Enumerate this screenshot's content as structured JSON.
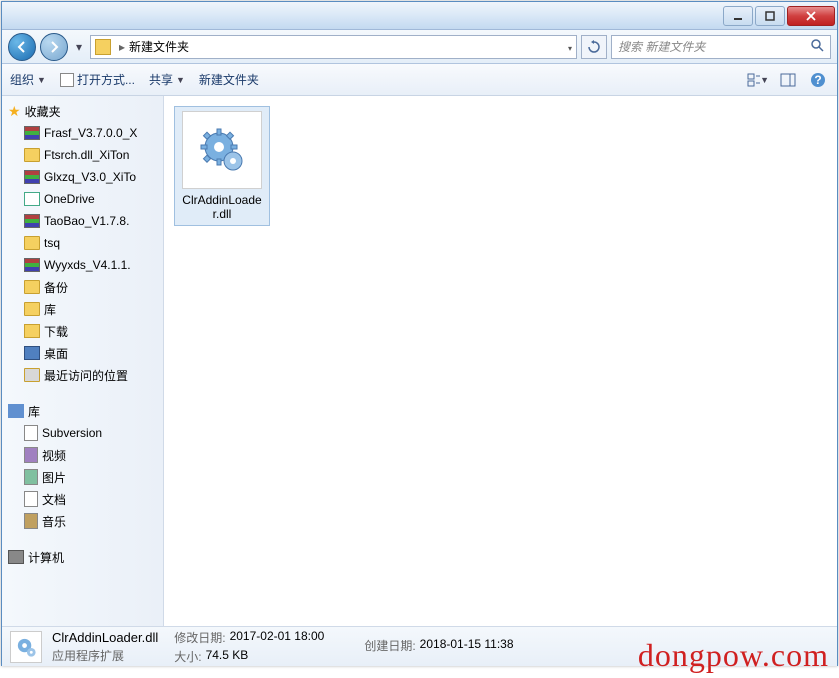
{
  "titlebar": {},
  "nav": {
    "path_item": "新建文件夹",
    "search_placeholder": "搜索 新建文件夹"
  },
  "toolbar": {
    "organize": "组织",
    "open_with": "打开方式...",
    "share": "共享",
    "new_folder": "新建文件夹"
  },
  "sidebar": {
    "favorites": "收藏夹",
    "fav_items": [
      {
        "label": "Frasf_V3.7.0.0_X",
        "icon": "arch"
      },
      {
        "label": "Ftsrch.dll_XiTon",
        "icon": "fold"
      },
      {
        "label": "Glxzq_V3.0_XiTo",
        "icon": "arch"
      },
      {
        "label": "OneDrive",
        "icon": "cloud"
      },
      {
        "label": "TaoBao_V1.7.8.",
        "icon": "arch"
      },
      {
        "label": "tsq",
        "icon": "fold"
      },
      {
        "label": "Wyyxds_V4.1.1.",
        "icon": "arch"
      },
      {
        "label": "备份",
        "icon": "fold"
      },
      {
        "label": "库",
        "icon": "fold"
      },
      {
        "label": "下载",
        "icon": "dl"
      },
      {
        "label": "桌面",
        "icon": "desk"
      },
      {
        "label": "最近访问的位置",
        "icon": "recent"
      }
    ],
    "libraries": "库",
    "lib_items": [
      {
        "label": "Subversion",
        "icon": "doc"
      },
      {
        "label": "视频",
        "icon": "vid"
      },
      {
        "label": "图片",
        "icon": "pic"
      },
      {
        "label": "文档",
        "icon": "doc"
      },
      {
        "label": "音乐",
        "icon": "mus"
      }
    ],
    "computer": "计算机"
  },
  "content": {
    "files": [
      {
        "name": "ClrAddinLoader.dll"
      }
    ]
  },
  "details": {
    "name": "ClrAddinLoader.dll",
    "type": "应用程序扩展",
    "mod_label": "修改日期:",
    "mod_val": "2017-02-01 18:00",
    "size_label": "大小:",
    "size_val": "74.5 KB",
    "create_label": "创建日期:",
    "create_val": "2018-01-15 11:38"
  },
  "watermark": "dongpow.com"
}
